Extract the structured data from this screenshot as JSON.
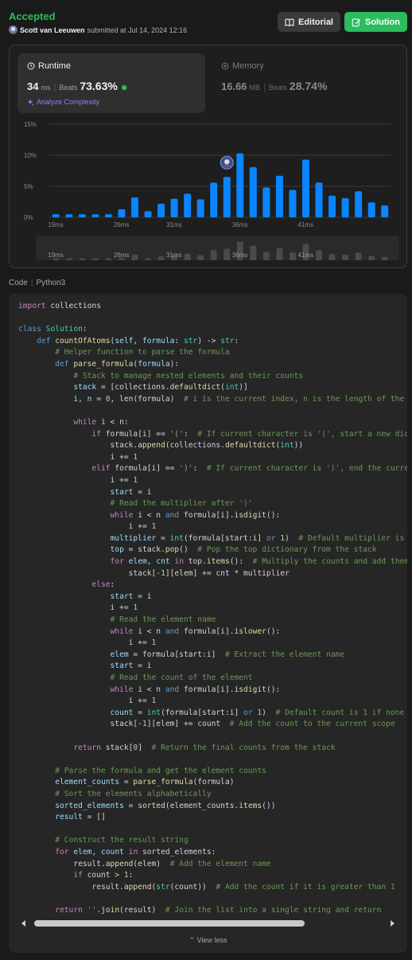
{
  "header": {
    "status": "Accepted",
    "author": "Scott van Leeuwen",
    "submitted_text": "submitted at Jul 14, 2024 12:16",
    "editorial_label": "Editorial",
    "solution_label": "Solution"
  },
  "runtime": {
    "title": "Runtime",
    "value": "34",
    "unit": "ms",
    "beats_label": "Beats",
    "beats_pct": "73.63%",
    "analyze_label": "Analyze Complexity"
  },
  "memory": {
    "title": "Memory",
    "value": "16.66",
    "unit": "MB",
    "beats_label": "Beats",
    "beats_pct": "28.74%"
  },
  "chart_data": {
    "type": "bar",
    "ylim": [
      0,
      15
    ],
    "y_ticks": [
      "15%",
      "10%",
      "5%",
      "0%"
    ],
    "x_tick_labels": [
      "19ms",
      "26ms",
      "31ms",
      "36ms",
      "41ms"
    ],
    "values": [
      0.5,
      0.5,
      0.5,
      0.5,
      0.5,
      1.3,
      3.2,
      1.0,
      2.2,
      3.0,
      3.8,
      2.9,
      5.6,
      6.5,
      10.3,
      8.1,
      4.8,
      6.7,
      4.4,
      9.3,
      5.6,
      3.5,
      3.1,
      4.2,
      2.4,
      1.9
    ],
    "highlight_index": 13,
    "grid": true,
    "colors": {
      "bar": "#0a84ff",
      "grid": "#3a3a3a",
      "mini_bar": "#4a4a4a"
    }
  },
  "code_section": {
    "label": "Code",
    "language": "Python3",
    "view_less_label": "View less"
  },
  "colors": {
    "accepted": "#2cbb5d",
    "solution_button": "#2cbb5d",
    "analyze": "#9b7dee",
    "background": "#1a1a1a"
  }
}
